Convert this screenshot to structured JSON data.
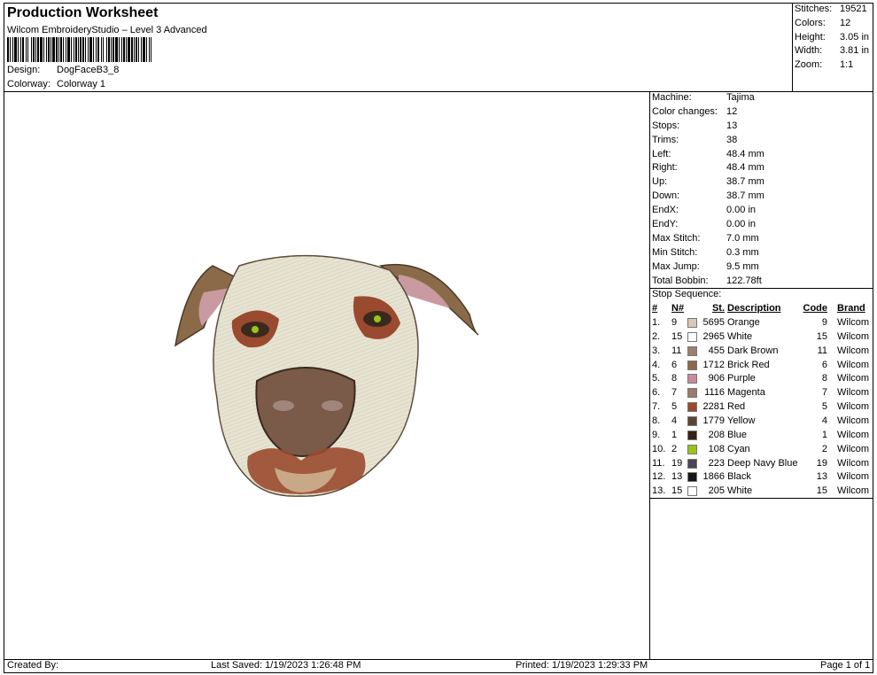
{
  "header": {
    "title": "Production Worksheet",
    "software": "Wilcom EmbroideryStudio – Level 3 Advanced",
    "design_label": "Design:",
    "design_value": "DogFaceB3_8",
    "colorway_label": "Colorway:",
    "colorway_value": "Colorway 1"
  },
  "summary": [
    {
      "label": "Stitches:",
      "value": "19521"
    },
    {
      "label": "Colors:",
      "value": "12"
    },
    {
      "label": "Height:",
      "value": "3.05 in"
    },
    {
      "label": "Width:",
      "value": "3.81 in"
    },
    {
      "label": "Zoom:",
      "value": "1:1"
    }
  ],
  "machine_info": [
    {
      "label": "Machine:",
      "value": "Tajima"
    },
    {
      "label": "Color changes:",
      "value": "12"
    },
    {
      "label": "Stops:",
      "value": "13"
    },
    {
      "label": "Trims:",
      "value": "38"
    },
    {
      "label": "Left:",
      "value": "48.4 mm"
    },
    {
      "label": "Right:",
      "value": "48.4 mm"
    },
    {
      "label": "Up:",
      "value": "38.7 mm"
    },
    {
      "label": "Down:",
      "value": "38.7 mm"
    },
    {
      "label": "EndX:",
      "value": "0.00 in"
    },
    {
      "label": "EndY:",
      "value": "0.00 in"
    },
    {
      "label": "Max Stitch:",
      "value": "7.0 mm"
    },
    {
      "label": "Min Stitch:",
      "value": "0.3 mm"
    },
    {
      "label": "Max Jump:",
      "value": "9.5 mm"
    },
    {
      "label": "Total Bobbin:",
      "value": "122.78ft"
    }
  ],
  "stop_sequence": {
    "title": "Stop Sequence:",
    "columns": {
      "idx": "#",
      "n": "N#",
      "st": "St.",
      "desc": "Description",
      "code": "Code",
      "brand": "Brand"
    },
    "rows": [
      {
        "idx": "1.",
        "n": "9",
        "color": "#d8c9b6",
        "st": "5695",
        "desc": "Orange",
        "code": "9",
        "brand": "Wilcom"
      },
      {
        "idx": "2.",
        "n": "15",
        "color": "#ffffff",
        "st": "2965",
        "desc": "White",
        "code": "15",
        "brand": "Wilcom"
      },
      {
        "idx": "3.",
        "n": "11",
        "color": "#9b8070",
        "st": "455",
        "desc": "Dark Brown",
        "code": "11",
        "brand": "Wilcom"
      },
      {
        "idx": "4.",
        "n": "6",
        "color": "#8b6a4e",
        "st": "1712",
        "desc": "Brick Red",
        "code": "6",
        "brand": "Wilcom"
      },
      {
        "idx": "5.",
        "n": "8",
        "color": "#c98a9a",
        "st": "906",
        "desc": "Purple",
        "code": "8",
        "brand": "Wilcom"
      },
      {
        "idx": "6.",
        "n": "7",
        "color": "#9c7a6c",
        "st": "1116",
        "desc": "Magenta",
        "code": "7",
        "brand": "Wilcom"
      },
      {
        "idx": "7.",
        "n": "5",
        "color": "#9a4a2e",
        "st": "2281",
        "desc": "Red",
        "code": "5",
        "brand": "Wilcom"
      },
      {
        "idx": "8.",
        "n": "4",
        "color": "#5a4630",
        "st": "1779",
        "desc": "Yellow",
        "code": "4",
        "brand": "Wilcom"
      },
      {
        "idx": "9.",
        "n": "1",
        "color": "#3a1f14",
        "st": "208",
        "desc": "Blue",
        "code": "1",
        "brand": "Wilcom"
      },
      {
        "idx": "10.",
        "n": "2",
        "color": "#9ac41a",
        "st": "108",
        "desc": "Cyan",
        "code": "2",
        "brand": "Wilcom"
      },
      {
        "idx": "11.",
        "n": "19",
        "color": "#4a4658",
        "st": "223",
        "desc": "Deep Navy Blue",
        "code": "19",
        "brand": "Wilcom"
      },
      {
        "idx": "12.",
        "n": "13",
        "color": "#151515",
        "st": "1866",
        "desc": "Black",
        "code": "13",
        "brand": "Wilcom"
      },
      {
        "idx": "13.",
        "n": "15",
        "color": "#ffffff",
        "st": "205",
        "desc": "White",
        "code": "15",
        "brand": "Wilcom"
      }
    ]
  },
  "footer": {
    "created_by": "Created By:",
    "last_saved": "Last Saved: 1/19/2023 1:26:48 PM",
    "printed": "Printed: 1/19/2023 1:29:33 PM",
    "page": "Page 1 of 1"
  },
  "icons": {
    "design_preview": "dog-face-embroidery-icon",
    "barcode": "barcode-icon"
  }
}
